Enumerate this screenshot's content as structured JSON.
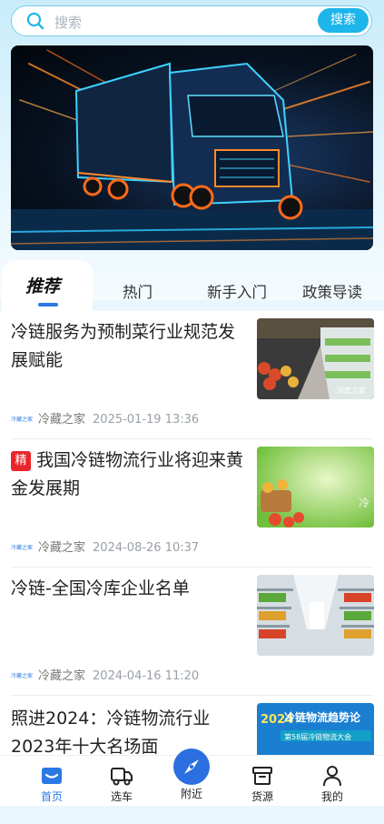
{
  "search": {
    "placeholder": "搜索",
    "button_label": "搜索"
  },
  "banner": {
    "slides_total": 1,
    "active_index": 0
  },
  "tabs": [
    {
      "label": "推荐",
      "active": true
    },
    {
      "label": "热门",
      "active": false
    },
    {
      "label": "新手入门",
      "active": false
    },
    {
      "label": "政策导读",
      "active": false
    }
  ],
  "articles": [
    {
      "title": "冷链服务为预制菜行业规范发展赋能",
      "badge": "",
      "source_logo": "冷藏之家",
      "source": "冷藏之家",
      "date": "2025-01-19 13:36",
      "thumb_caption": "冷库之家"
    },
    {
      "title": "我国冷链物流行业将迎来黄金发展期",
      "badge": "精",
      "source_logo": "冷藏之家",
      "source": "冷藏之家",
      "date": "2024-08-26 10:37",
      "thumb_caption": "冷"
    },
    {
      "title": "冷链-全国冷库企业名单",
      "badge": "",
      "source_logo": "冷藏之家",
      "source": "冷藏之家",
      "date": "2024-04-16 11:20",
      "thumb_caption": ""
    },
    {
      "title": "照进2024：冷链物流行业2023年十大名场面",
      "badge": "",
      "source_logo": "",
      "source": "",
      "date": "",
      "thumb_caption": "冷链物流趋势论",
      "thumb_caption2": "第58届冷链物流大会",
      "thumb_year": "2024"
    }
  ],
  "nav": [
    {
      "label": "首页",
      "icon": "home-icon",
      "active": true
    },
    {
      "label": "选车",
      "icon": "truck-icon",
      "active": false
    },
    {
      "label": "附近",
      "icon": "compass-icon",
      "active": false
    },
    {
      "label": "货源",
      "icon": "box-icon",
      "active": false
    },
    {
      "label": "我的",
      "icon": "user-icon",
      "active": false
    }
  ],
  "colors": {
    "accent": "#2b78e4",
    "search_button": "#1db6ea",
    "badge": "#e9262c"
  }
}
